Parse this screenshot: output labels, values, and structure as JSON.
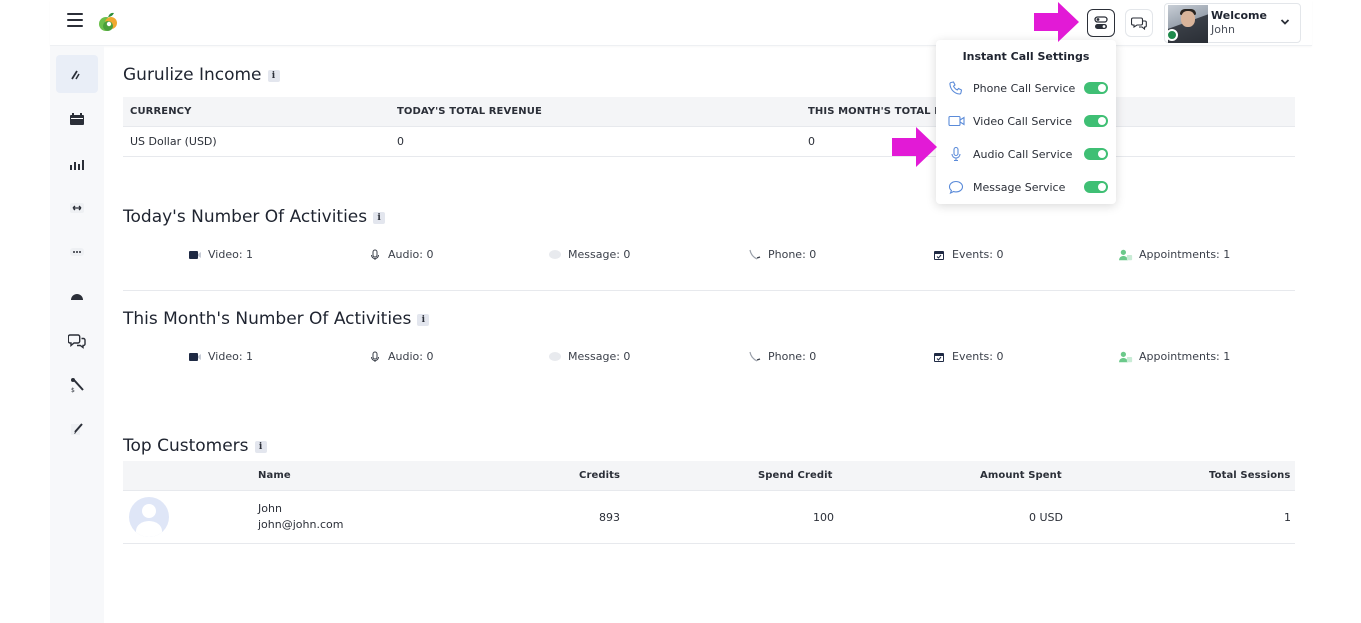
{
  "header": {
    "welcome": "Welcome",
    "user_name": "John"
  },
  "sidebar": {
    "items": [
      {
        "name": "dashboard-icon"
      },
      {
        "name": "calendar-icon"
      },
      {
        "name": "bar-chart-icon"
      },
      {
        "name": "transfer-icon"
      },
      {
        "name": "more-dots-icon"
      },
      {
        "name": "half-circle-icon"
      },
      {
        "name": "chat-icon"
      },
      {
        "name": "wrench-icon"
      },
      {
        "name": "edit-icon"
      }
    ]
  },
  "income": {
    "title": "Gurulize Income",
    "headers": [
      "CURRENCY",
      "TODAY'S TOTAL REVENUE",
      "THIS MONTH'S TOTAL RE"
    ],
    "row": [
      "US Dollar (USD)",
      "0",
      "0"
    ]
  },
  "today": {
    "title": "Today's Number Of Activities",
    "items": [
      "Video: 1",
      "Audio: 0",
      "Message: 0",
      "Phone: 0",
      "Events: 0",
      "Appointments: 1"
    ]
  },
  "month": {
    "title": "This Month's Number Of Activities",
    "items": [
      "Video: 1",
      "Audio: 0",
      "Message: 0",
      "Phone: 0",
      "Events: 0",
      "Appointments: 1"
    ]
  },
  "customers": {
    "title": "Top Customers",
    "headers": [
      "Name",
      "Credits",
      "Spend Credit",
      "Amount Spent",
      "Total Sessions"
    ],
    "rows": [
      {
        "name": "John",
        "email": "john@john.com",
        "credits": "893",
        "spend_credit": "100",
        "amount_spent": "0 USD",
        "total_sessions": "1"
      }
    ]
  },
  "popup": {
    "title": "Instant Call Settings",
    "services": [
      {
        "label": "Phone Call Service",
        "enabled": true
      },
      {
        "label": "Video Call Service",
        "enabled": true
      },
      {
        "label": "Audio Call Service",
        "enabled": true
      },
      {
        "label": "Message Service",
        "enabled": true
      }
    ]
  },
  "colors": {
    "toggle_on": "#3fbf74",
    "arrow": "#e21ad6",
    "icon_blue": "#5b8bd9"
  }
}
